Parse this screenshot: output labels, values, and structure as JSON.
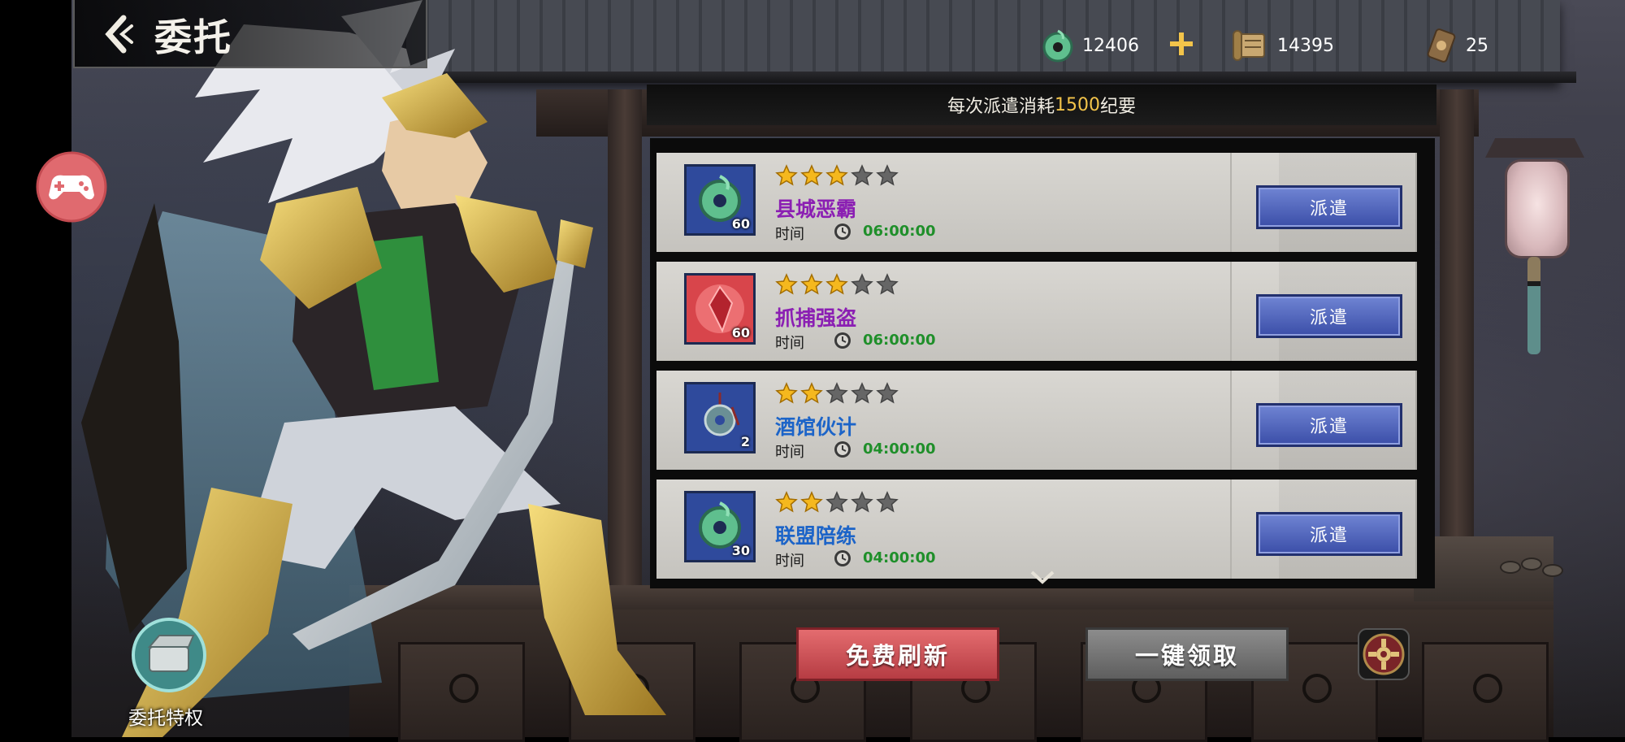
{
  "header": {
    "title": "委托",
    "back_icon": "chevron-left-icon"
  },
  "currencies": [
    {
      "icon": "jade-coin-icon",
      "value": "12406"
    },
    {
      "icon": "scroll-icon",
      "value": "14395"
    },
    {
      "icon": "token-icon",
      "value": "25"
    }
  ],
  "cost_banner": {
    "prefix": "每次派遣消耗",
    "amount": "1500",
    "suffix": "纪要"
  },
  "quests": [
    {
      "icon": "jade-coin-icon",
      "count": "60",
      "stars": 3,
      "max_stars": 5,
      "name": "县城恶霸",
      "name_color": "#8b1fb3",
      "time_label": "时间",
      "time": "06:00:00",
      "button": "派遣"
    },
    {
      "icon": "red-crystal-icon",
      "count": "60",
      "stars": 3,
      "max_stars": 5,
      "name": "抓捕强盗",
      "name_color": "#8b1fb3",
      "time_label": "时间",
      "time": "06:00:00",
      "button": "派遣"
    },
    {
      "icon": "jade-pendant-icon",
      "count": "2",
      "stars": 2,
      "max_stars": 5,
      "name": "酒馆伙计",
      "name_color": "#1c64c8",
      "time_label": "时间",
      "time": "04:00:00",
      "button": "派遣"
    },
    {
      "icon": "jade-coin-icon",
      "count": "30",
      "stars": 2,
      "max_stars": 5,
      "name": "联盟陪练",
      "name_color": "#1c64c8",
      "time_label": "时间",
      "time": "04:00:00",
      "button": "派遣"
    }
  ],
  "actions": {
    "refresh": "免费刷新",
    "collect_all": "一键领取",
    "settings_icon": "gear-icon"
  },
  "privilege": {
    "label": "委托特权",
    "icon": "chest-icon"
  },
  "overlay": {
    "gamepad_icon": "gamepad-icon"
  },
  "colors": {
    "accent_gold": "#f3c44a",
    "dispatch_blue": "#3b4ea8",
    "refresh_red": "#b63c43",
    "time_green": "#1f8f2a"
  }
}
